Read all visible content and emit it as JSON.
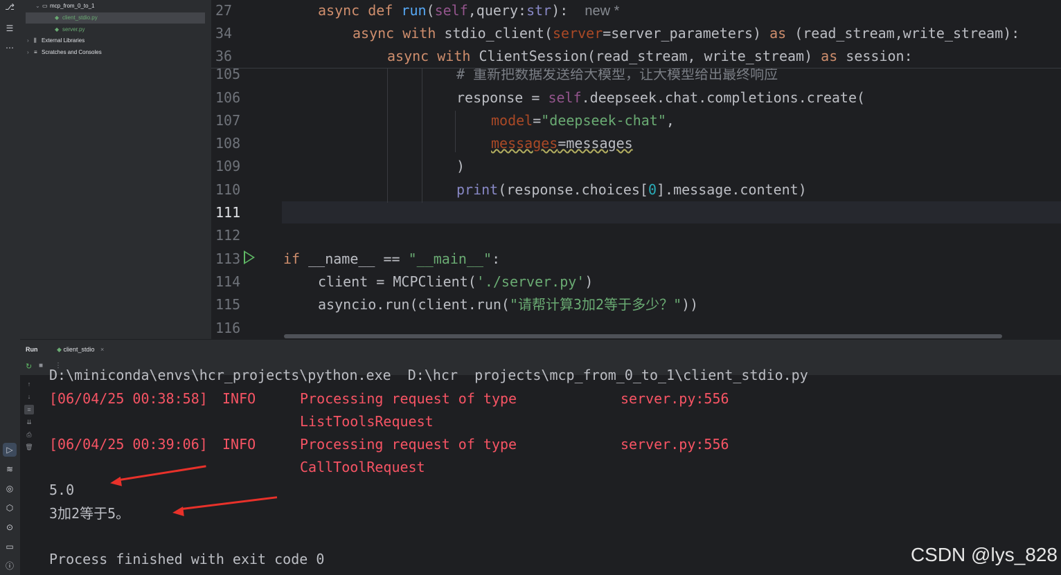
{
  "project_tree": {
    "items": [
      {
        "label": "mcp_from_0_to_1",
        "icon": "folder-icon",
        "arrow": "⌄"
      },
      {
        "label": "client_stdio.py",
        "icon": "python-file-icon"
      },
      {
        "label": "server.py",
        "icon": "python-file-icon"
      },
      {
        "label": "External Libraries",
        "icon": "library-icon",
        "arrow": "›"
      },
      {
        "label": "Scratches and Consoles",
        "icon": "scratches-icon",
        "arrow": "›"
      }
    ]
  },
  "editor": {
    "sticky_lines": [
      {
        "number": "27",
        "text": "async def run(self,query:str):",
        "hint": "new *"
      },
      {
        "number": "34",
        "text": "async with stdio_client(server=server_parameters) as (read_stream,write_stream):"
      },
      {
        "number": "36",
        "text": "async with ClientSession(read_stream, write_stream) as session:"
      }
    ],
    "lines": [
      {
        "number": "105",
        "text": "# 重新把数据发送给大模型，让大模型给出最终响应"
      },
      {
        "number": "106",
        "text": "response = self.deepseek.chat.completions.create("
      },
      {
        "number": "107",
        "text": "model=\"deepseek-chat\","
      },
      {
        "number": "108",
        "text": "messages=messages"
      },
      {
        "number": "109",
        "text": ")"
      },
      {
        "number": "110",
        "text": "print(response.choices[0].message.content)"
      },
      {
        "number": "111",
        "text": ""
      },
      {
        "number": "112",
        "text": ""
      },
      {
        "number": "113",
        "text": "if __name__ == \"__main__\":"
      },
      {
        "number": "114",
        "text": "client = MCPClient('./server.py')"
      },
      {
        "number": "115",
        "text": "asyncio.run(client.run(\"请帮计算3加2等于多少？\"))"
      },
      {
        "number": "116",
        "text": ""
      }
    ]
  },
  "run_panel": {
    "title": "Run",
    "tab_label": "client_stdio",
    "close_glyph": "×",
    "console": {
      "command_line": "D:\\miniconda\\envs\\hcr_projects\\python.exe  D:\\hcr  projects\\mcp_from_0_to_1\\client_stdio.py",
      "logs": [
        {
          "time": "[06/04/25 00:38:58]",
          "level": "INFO",
          "message": "Processing request of type",
          "message2": "ListToolsRequest",
          "source": "server.py:556"
        },
        {
          "time": "[06/04/25 00:39:06]",
          "level": "INFO",
          "message": "Processing request of type",
          "message2": "CallToolRequest",
          "source": "server.py:556"
        }
      ],
      "output_1": "5.0",
      "output_2": "3加2等于5。",
      "exit": "Process finished with exit code 0"
    }
  },
  "watermark": "CSDN @lys_828",
  "colors": {
    "accent": "#3574f0",
    "arrow": "#e8312a",
    "log_red": "#f75464"
  }
}
